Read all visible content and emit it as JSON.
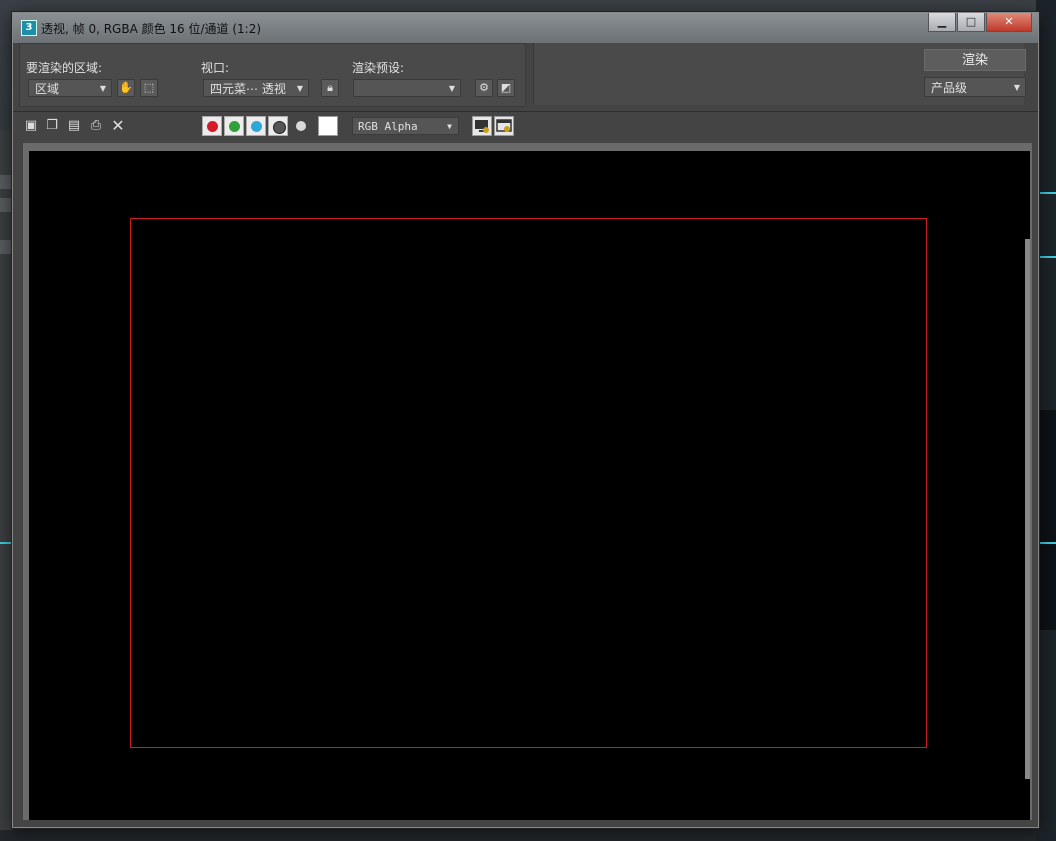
{
  "window": {
    "app_icon": "3",
    "title": "透视, 帧 0, RGBA 颜色 16 位/通道 (1:2)",
    "controls": {
      "minimize": "▁",
      "maximize": "□",
      "close": "✕"
    }
  },
  "render_area": {
    "label": "要渲染的区域:",
    "value": "区域",
    "pan_icon": "hand-icon",
    "region_icon": "region-select-icon"
  },
  "viewport": {
    "label": "视口:",
    "value": "四元菜⋯ 透视",
    "lock_icon": "lock-icon"
  },
  "render_preset": {
    "label": "渲染预设:",
    "value": "",
    "setup_icon": "render-setup-icon",
    "env_icon": "environment-icon"
  },
  "render": {
    "button_label": "渲染",
    "quality_value": "产品级"
  },
  "toolbar": {
    "icons": [
      "save-icon",
      "copy-icon",
      "clone-icon",
      "print-icon",
      "clear-icon"
    ],
    "channel_colors": {
      "red": "#d61a2a",
      "green": "#2fa03a",
      "blue": "#2aa9d8"
    },
    "channel_select": "RGB Alpha"
  },
  "canvas": {
    "background": "#000000",
    "safe_frame_color": "#c81e1e"
  }
}
